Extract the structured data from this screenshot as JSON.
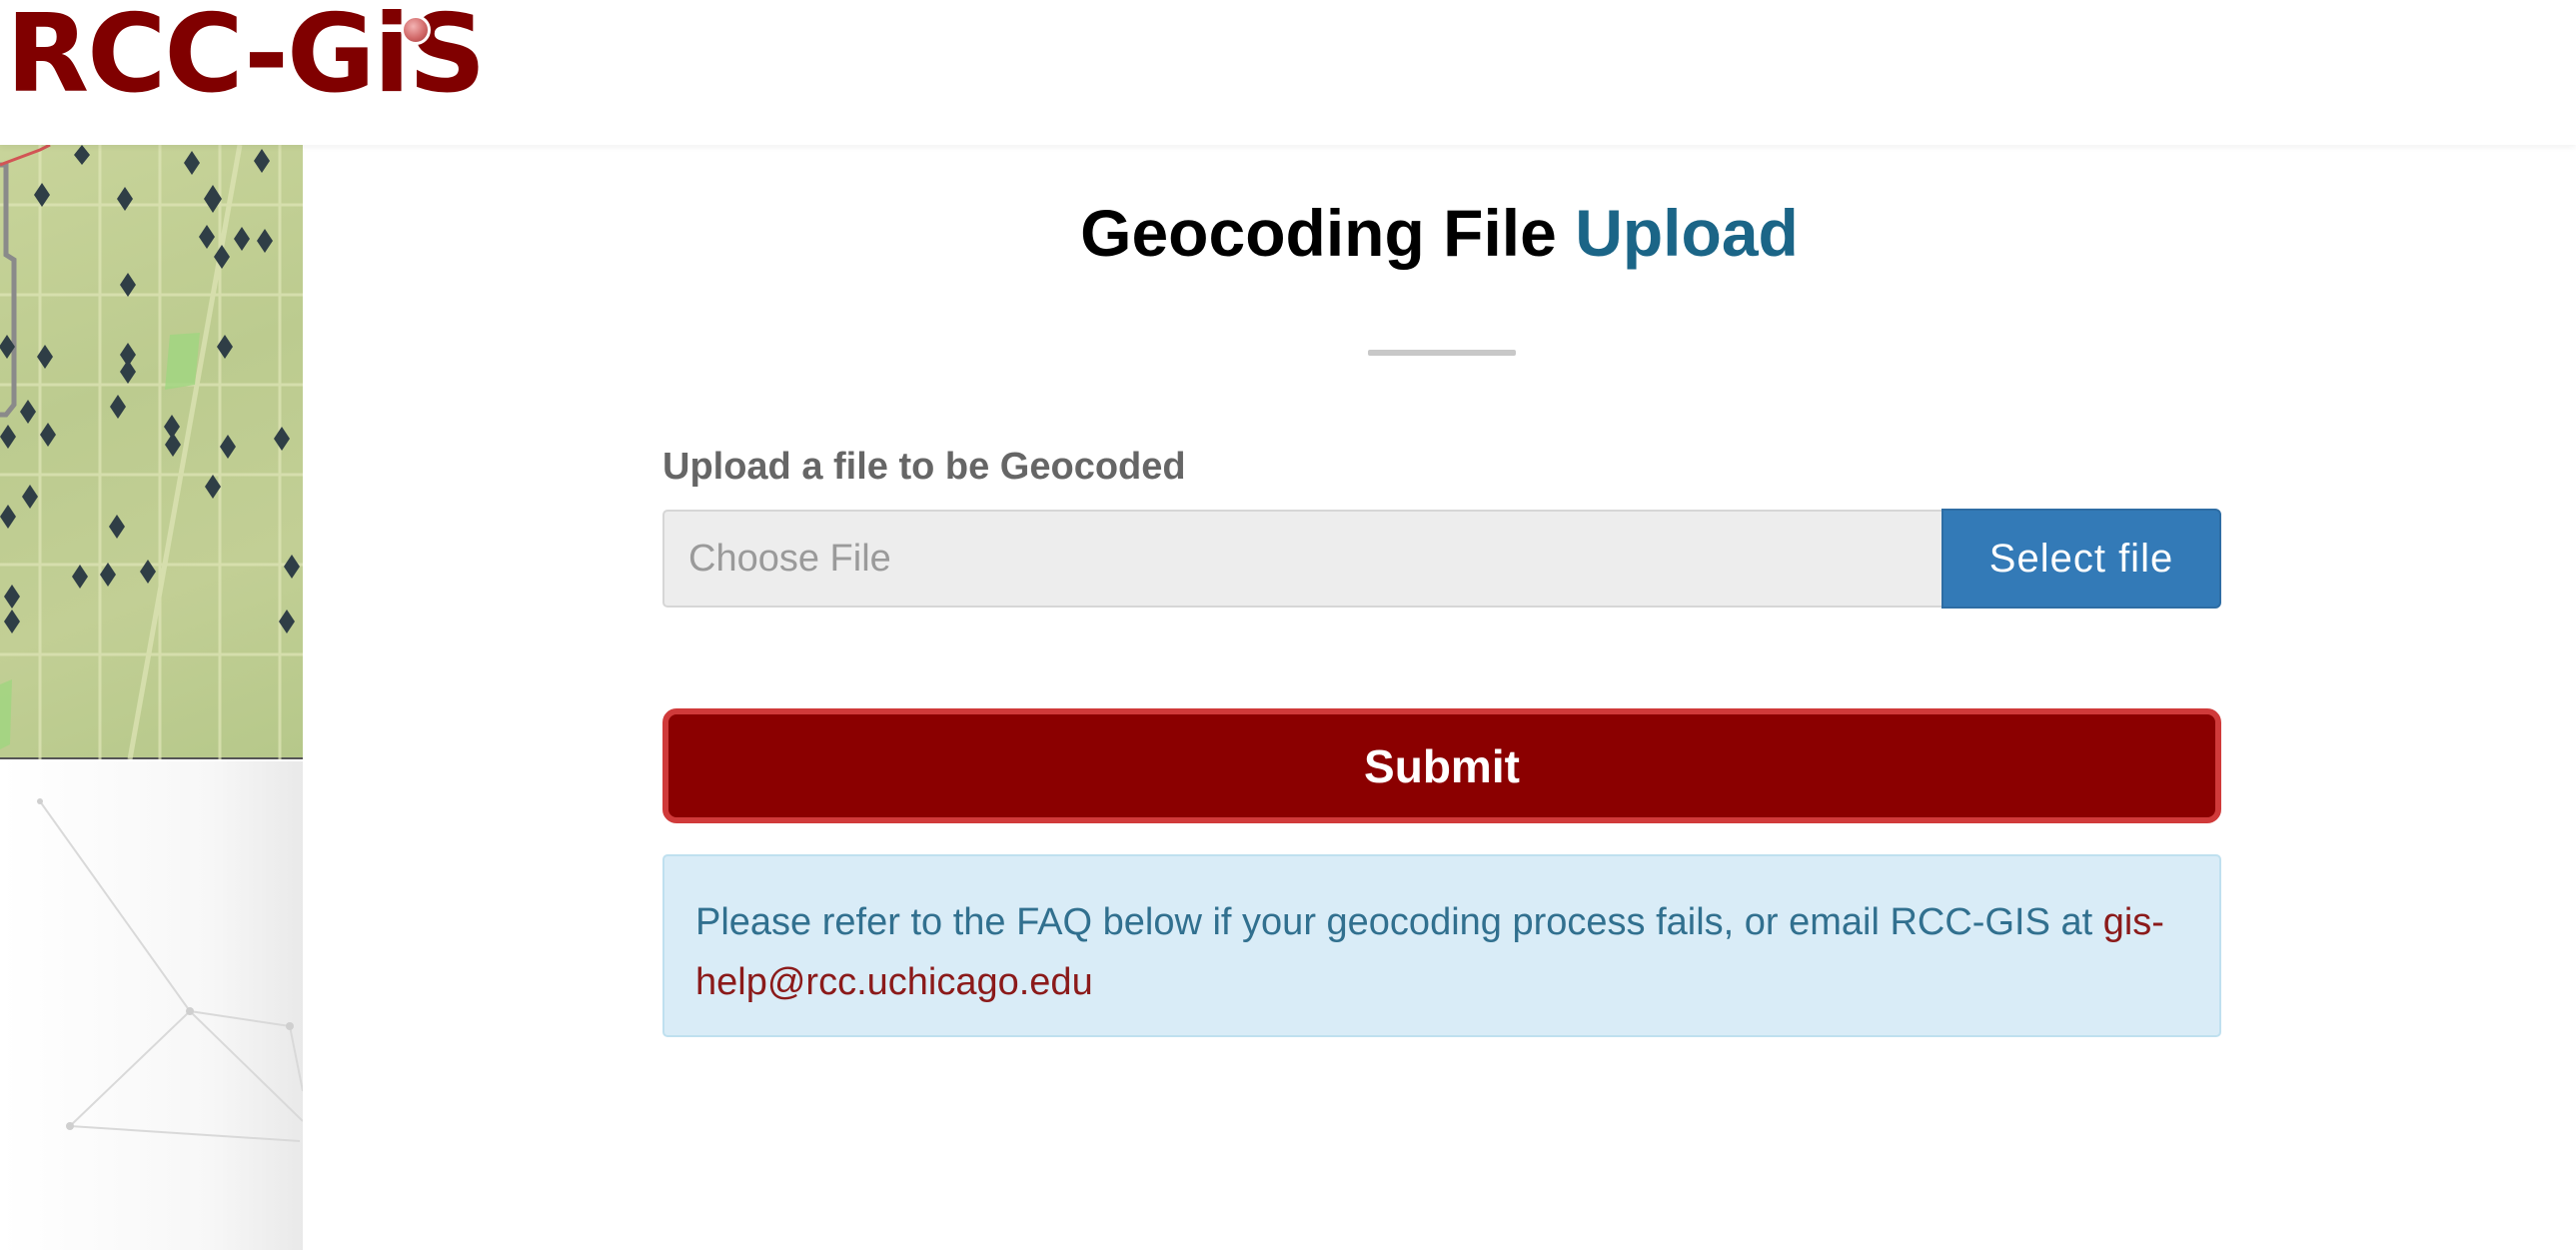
{
  "header": {
    "logo_text": "RCC-GiS"
  },
  "main": {
    "title_part1": "Geocoding File",
    "title_part2": "Upload",
    "field_label": "Upload a file to be Geocoded",
    "file_placeholder": "Choose File",
    "select_button_label": "Select file",
    "submit_label": "Submit",
    "info_text": "Please refer to the FAQ below if your geocoding process fails, or email RCC-GIS at ",
    "info_email": "gis-help@rcc.uchicago.edu"
  },
  "colors": {
    "brand": "#800000",
    "title_accent": "#1b6587",
    "select_button": "#337ab7",
    "submit_button": "#8b0000",
    "info_background": "#d9ecf7"
  },
  "icons": {
    "map_markers": "diamond-marker-icon"
  }
}
